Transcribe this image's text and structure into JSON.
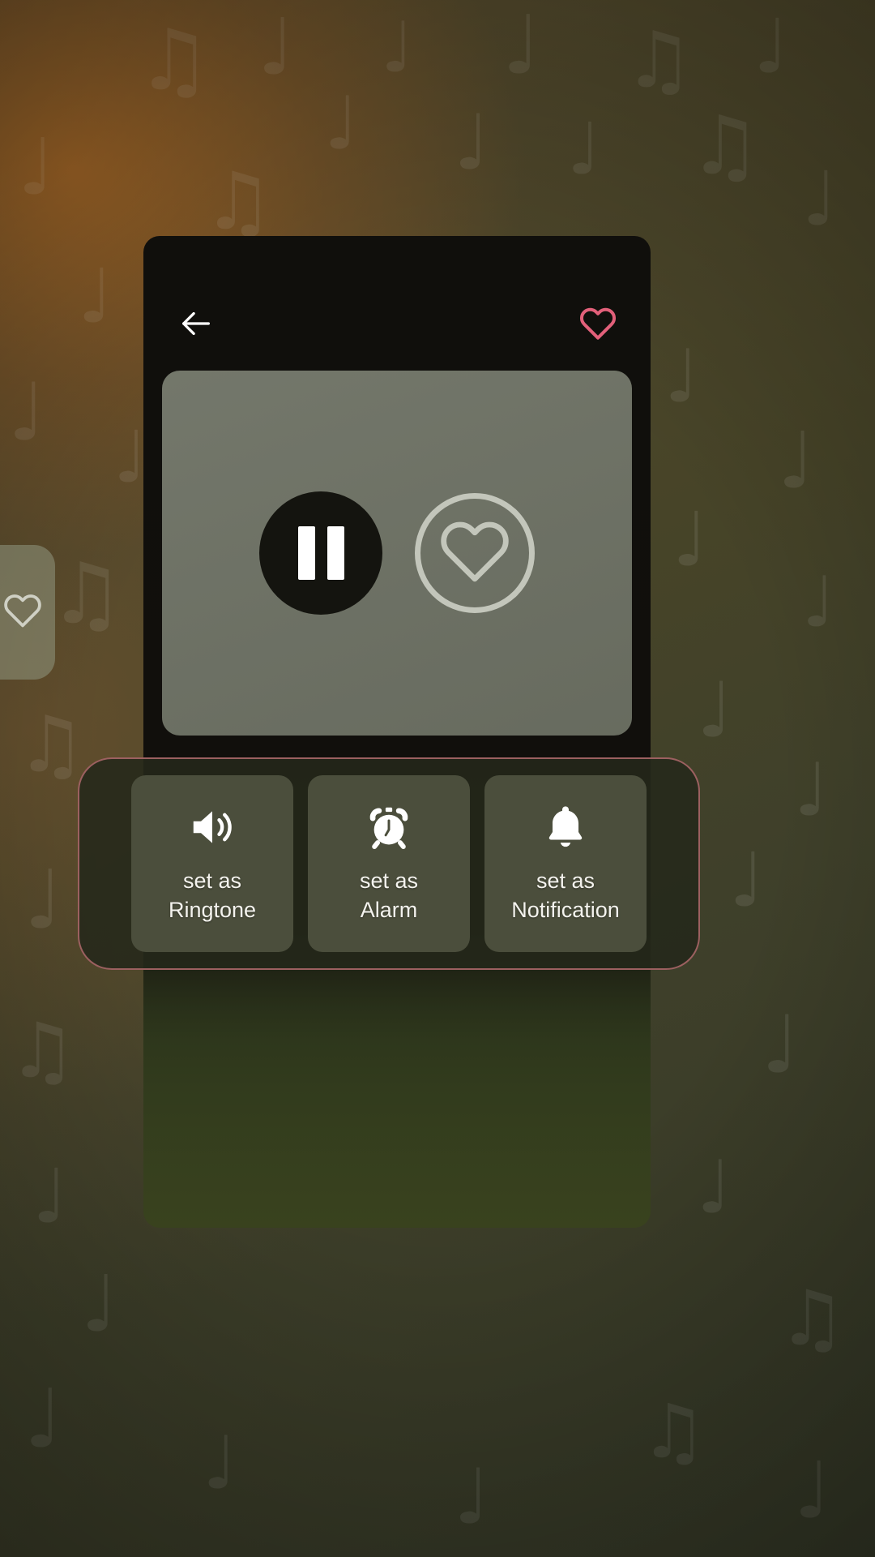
{
  "app": {
    "screen_name": "music-player-set-as-sheet",
    "background_pattern_icon": "music-note-icon"
  },
  "colors": {
    "sheet_background": "#110f0c",
    "artwork_background": "#6d7164",
    "accent_heart": "#e2607a",
    "action_bar_border": "#9c6060",
    "tile_background": "#4b4e3c",
    "pause_button": "#14140f",
    "label_text": "#f4f3ee",
    "bottom_glow": "#39421e"
  },
  "top_bar": {
    "back_icon": "arrow-left-icon",
    "favorite_icon": "heart-outline-icon"
  },
  "artwork": {
    "play_pause_icon": "pause-icon",
    "play_pause_state": "playing",
    "favorite_circle_icon": "heart-outline-in-circle-icon"
  },
  "peek_card": {
    "icon": "heart-outline-icon"
  },
  "set_as_bar": {
    "tiles": [
      {
        "icon": "volume-high-icon",
        "label": "set as\nRingtone",
        "line1": "set as",
        "line2": "Ringtone"
      },
      {
        "icon": "alarm-clock-icon",
        "label": "set as\nAlarm",
        "line1": "set as",
        "line2": "Alarm"
      },
      {
        "icon": "bell-icon",
        "label": "set as\nNotification",
        "line1": "set as",
        "line2": "Notification"
      }
    ]
  }
}
